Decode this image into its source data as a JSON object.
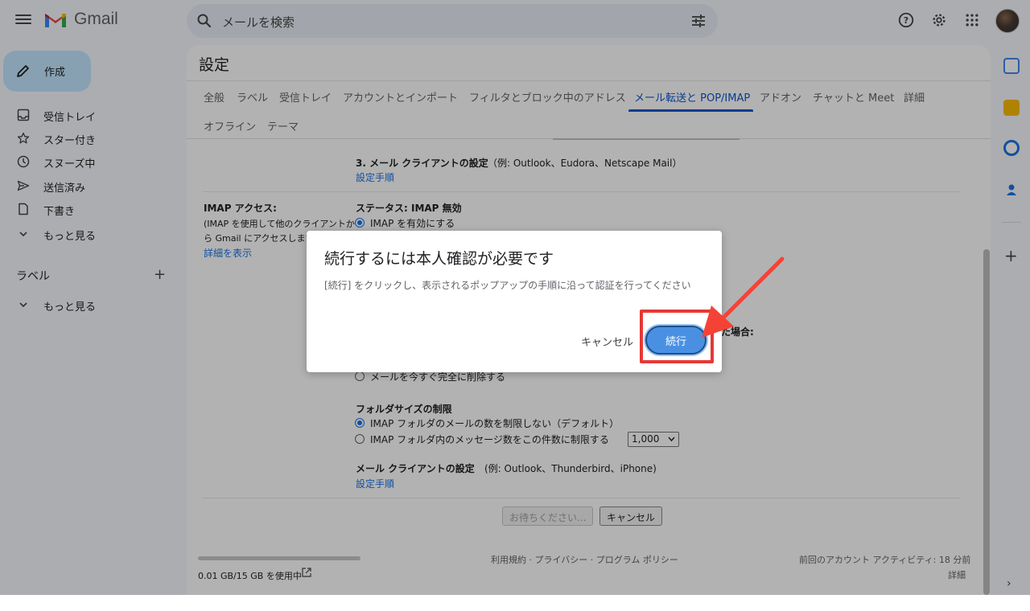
{
  "app": {
    "name": "Gmail"
  },
  "search": {
    "placeholder": "メールを検索"
  },
  "sidebar": {
    "compose": "作成",
    "items": [
      {
        "label": "受信トレイ",
        "icon": "inbox-icon"
      },
      {
        "label": "スター付き",
        "icon": "star-icon"
      },
      {
        "label": "スヌーズ中",
        "icon": "clock-icon"
      },
      {
        "label": "送信済み",
        "icon": "send-icon"
      },
      {
        "label": "下書き",
        "icon": "draft-icon"
      },
      {
        "label": "もっと見る",
        "icon": "chevron-down-icon"
      }
    ],
    "labels_heading": "ラベル",
    "labels_more": "もっと見る"
  },
  "settings": {
    "title": "設定",
    "tabs": [
      "全般",
      "ラベル",
      "受信トレイ",
      "アカウントとインポート",
      "フィルタとブロック中のアドレス",
      "メール転送と POP/IMAP",
      "アドオン",
      "チャットと Meet",
      "詳細",
      "オフライン",
      "テーマ"
    ],
    "active_tab": "メール転送と POP/IMAP",
    "pop_client_heading": "3. メール クライアントの設定",
    "pop_client_example": "（例: Outlook、Eudora、Netscape Mail）",
    "pop_setup_link": "設定手順",
    "imap_label": "IMAP アクセス:",
    "imap_desc_1": "(IMAP を使用して他のクライアントか",
    "imap_desc_2": "ら Gmail にアクセスします",
    "imap_details_link": "詳細を表示",
    "imap_status": "ステータス: IMAP 無効",
    "imap_enable": "IMAP を有効にする",
    "partial_heading": "た場合:",
    "delete_now": "メールを今すぐ完全に削除する",
    "folder_size_heading": "フォルダサイズの制限",
    "folder_no_limit": "IMAP フォルダのメールの数を制限しない（デフォルト）",
    "folder_limit": "IMAP フォルダ内のメッセージ数をこの件数に制限する",
    "folder_limit_value": "1,000",
    "imap_client_heading": "メール クライアントの設定",
    "imap_client_example": "(例: Outlook、Thunderbird、iPhone)",
    "imap_setup_link": "設定手順",
    "save_button": "お待ちください...",
    "cancel_button": "キャンセル"
  },
  "footer": {
    "storage": "0.01 GB/15 GB を使用中",
    "policies": "利用規約 · プライバシー · プログラム ポリシー",
    "last_activity": "前回のアカウント アクティビティ: 18 分前",
    "details": "詳細"
  },
  "dialog": {
    "title": "続行するには本人確認が必要です",
    "body": "[続行] をクリックし、表示されるポップアップの手順に沿って認証を行ってください",
    "cancel": "キャンセル",
    "continue": "続行"
  },
  "colors": {
    "accent": "#0b57d0",
    "compose_bg": "#c2e7ff",
    "highlight": "#e53935",
    "continue_bg": "#4a90e2"
  }
}
